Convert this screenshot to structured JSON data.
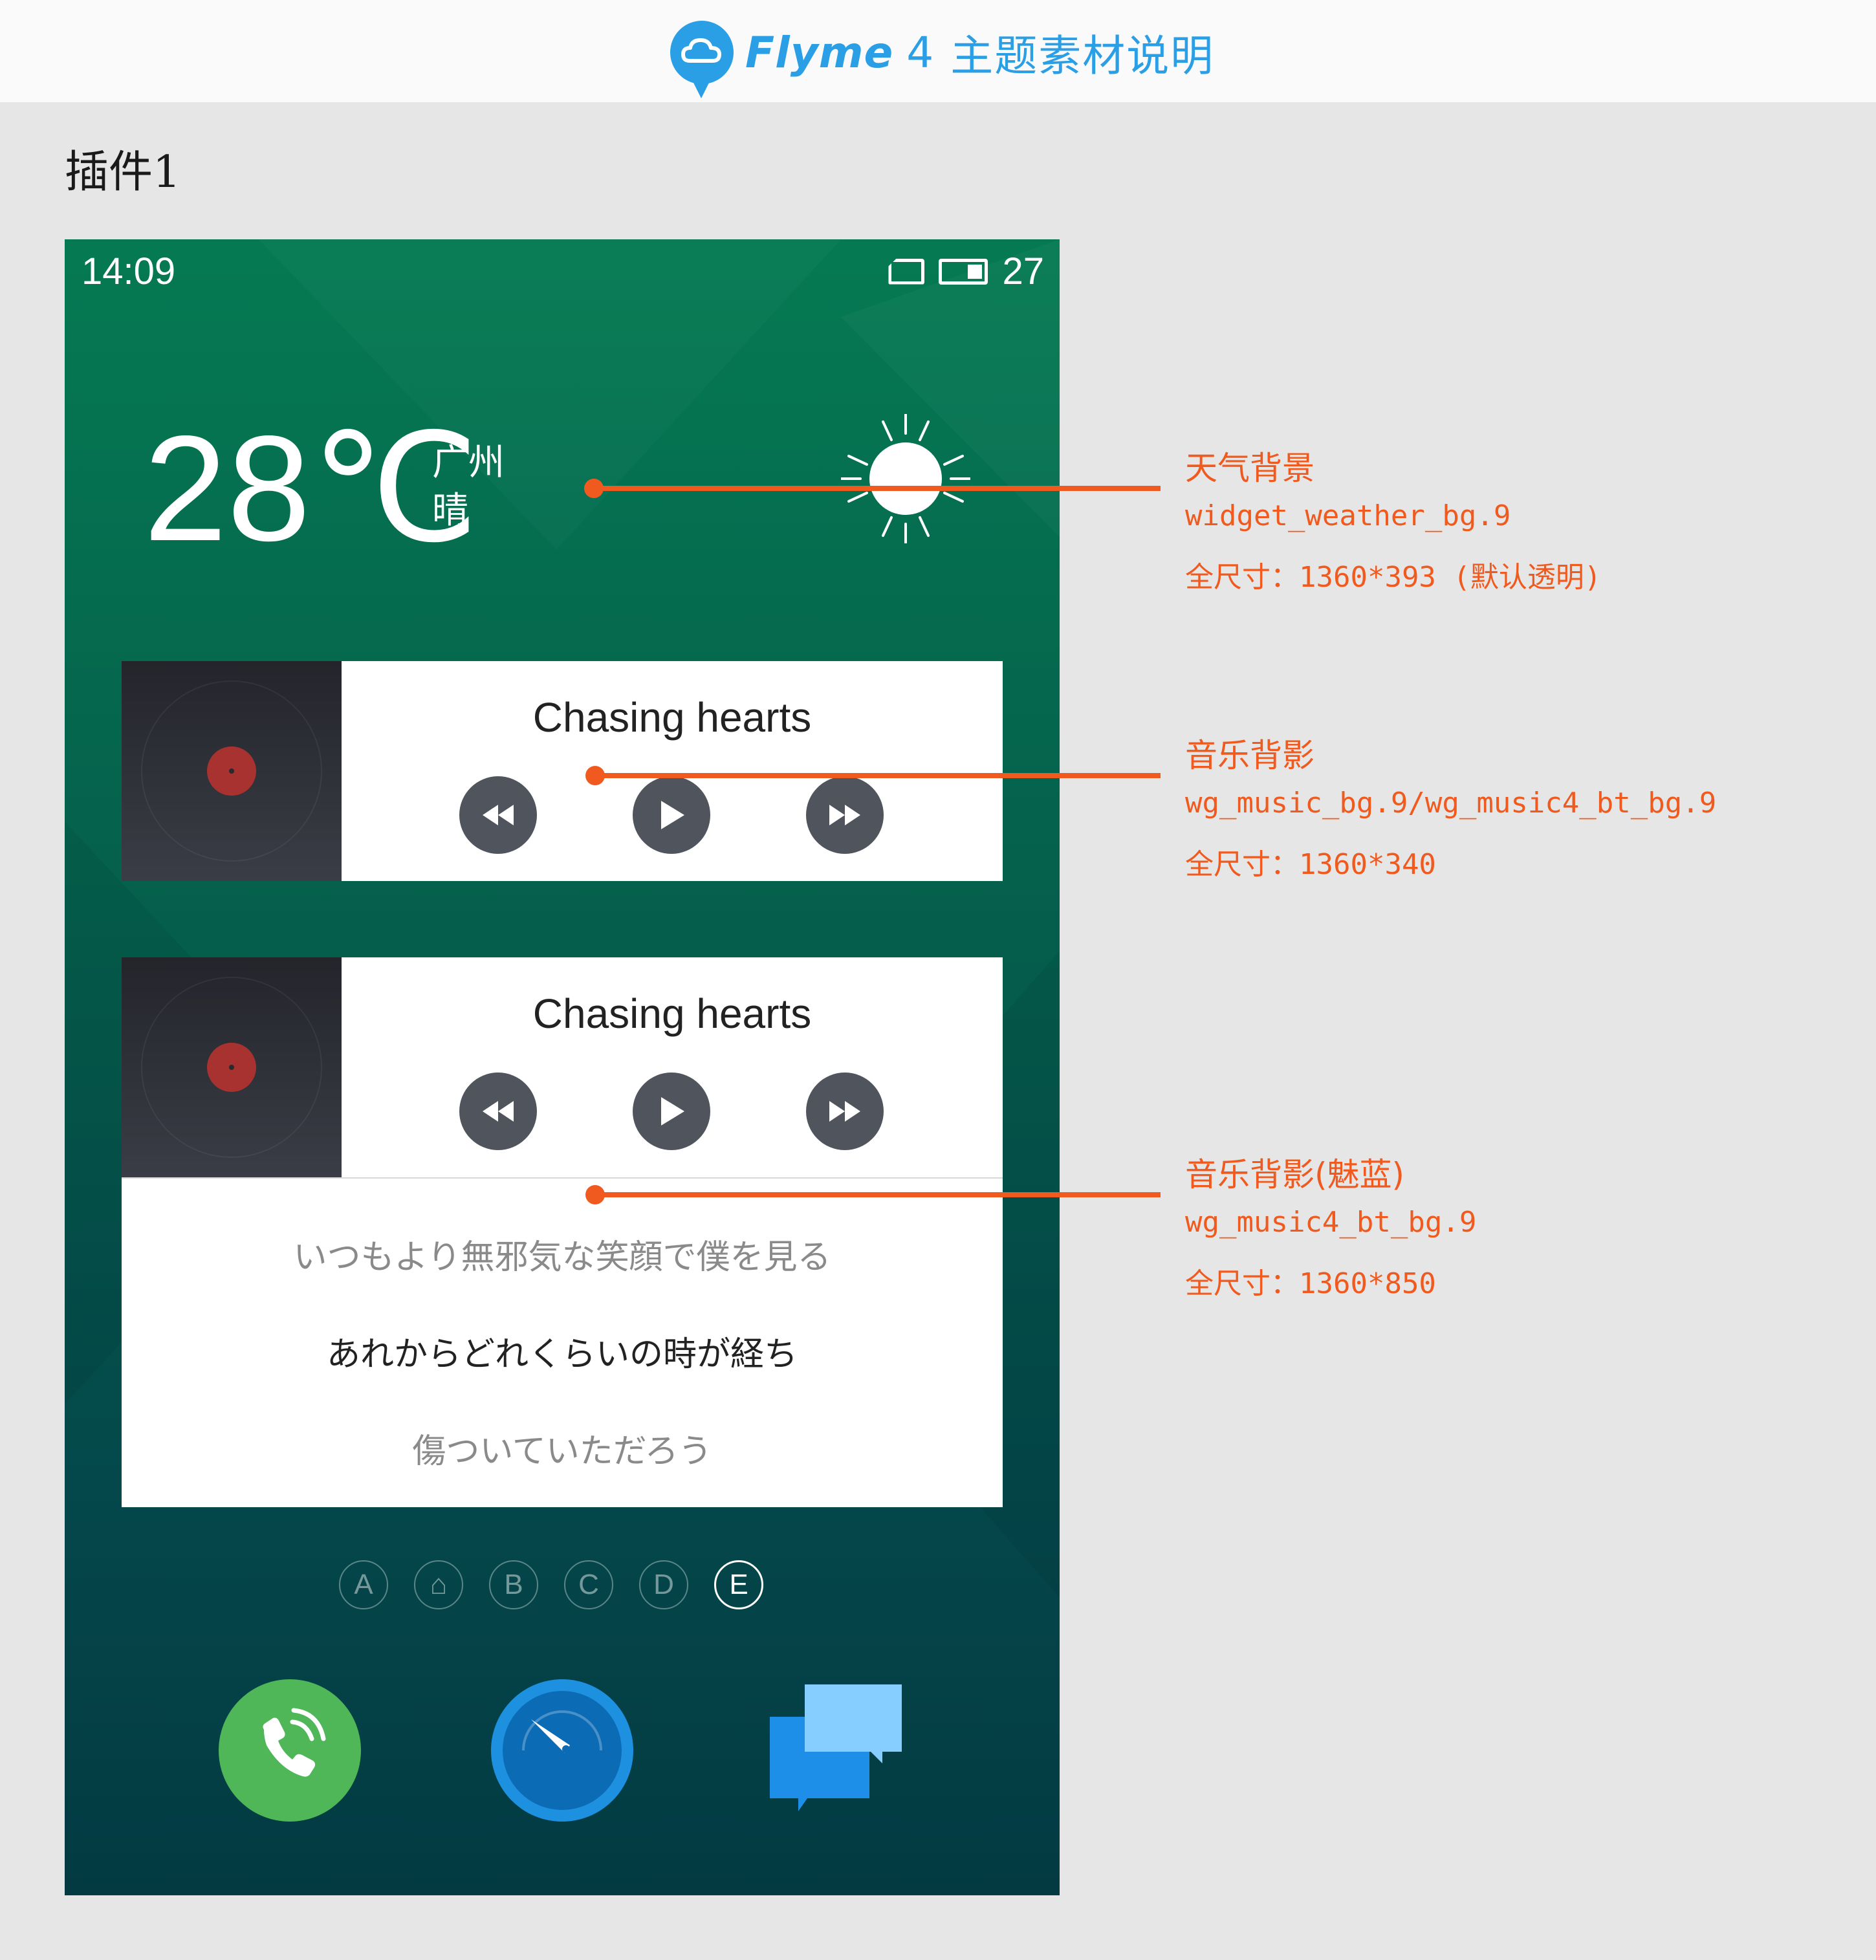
{
  "header": {
    "brand_name": "Flyme",
    "version": "4",
    "subtitle": "主题素材说明",
    "brand_color": "#2a9fe6"
  },
  "section": {
    "title": "插件1"
  },
  "status_bar": {
    "time": "14:09",
    "battery": "27",
    "icons": [
      "sim-card-icon",
      "battery-icon"
    ]
  },
  "weather": {
    "temperature": "28℃",
    "city": "广州",
    "condition": "晴",
    "icon": "sun-icon"
  },
  "music_widgets": [
    {
      "song": "Chasing hearts",
      "controls": [
        "rewind",
        "play",
        "fast-forward"
      ]
    },
    {
      "song": "Chasing hearts",
      "controls": [
        "rewind",
        "play",
        "fast-forward"
      ],
      "lyrics": [
        "いつもより無邪気な笑顔で僕を見る",
        "あれからどれくらいの時が経ち",
        "傷ついていただろう"
      ]
    }
  ],
  "page_indicators": [
    "A",
    "⌂",
    "B",
    "C",
    "D",
    "E"
  ],
  "active_page": "E",
  "dock": [
    "phone-icon",
    "browser-compass-icon",
    "messages-icon"
  ],
  "annotations": [
    {
      "title": "天气背景",
      "file": "widget_weather_bg.9",
      "size": "全尺寸：1360*393 (默认透明)"
    },
    {
      "title": "音乐背影",
      "file": "wg_music_bg.9/wg_music4_bt_bg.9",
      "size": "全尺寸：1360*340"
    },
    {
      "title": "音乐背影(魅蓝)",
      "file": "wg_music4_bt_bg.9",
      "size": "全尺寸：1360*850"
    }
  ],
  "colors": {
    "annotation": "#f05a1e",
    "background": "#e6e6e6",
    "phone_bg_top": "#057a52",
    "phone_bg_bottom": "#033a42"
  }
}
